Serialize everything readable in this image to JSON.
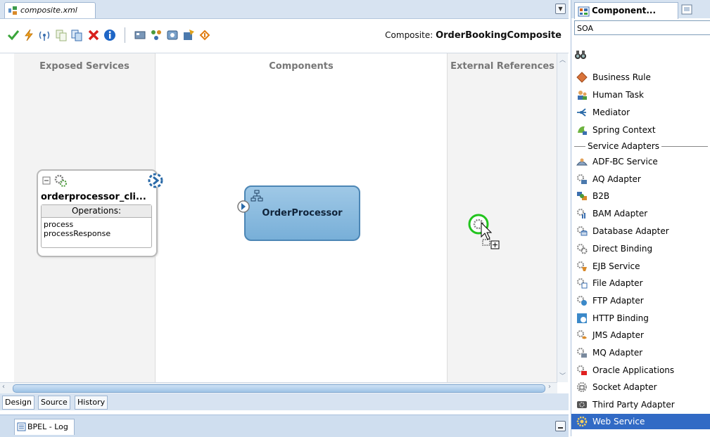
{
  "editor_tab": {
    "label": "composite.xml",
    "icon": "composite-file-icon"
  },
  "toolbar": {
    "buttons": [
      "validate-check-icon",
      "lightning-icon",
      "wireless-icon",
      "copy-doc-icon",
      "paste-doc-icon",
      "delete-x-icon",
      "info-icon",
      "tool-1-icon",
      "tool-2-icon",
      "tool-3-icon",
      "tool-4-icon",
      "tool-5-icon"
    ],
    "composite_prefix": "Composite:",
    "composite_name": "OrderBookingComposite"
  },
  "canvas": {
    "lanes": {
      "services": "Exposed Services",
      "components": "Components",
      "references": "External References"
    },
    "service": {
      "name": "orderprocessor_cli...",
      "ops_header": "Operations:",
      "ops": [
        "process",
        "processResponse"
      ]
    },
    "component": {
      "name": "OrderProcessor"
    }
  },
  "design_tabs": [
    "Design",
    "Source",
    "History"
  ],
  "log_tab": {
    "label": "BPEL - Log"
  },
  "palette": {
    "tab_label": "Component...",
    "category": "SOA",
    "section": "Service Adapters",
    "items": [
      {
        "label": "Business Rule",
        "icon": "business-rule-icon"
      },
      {
        "label": "Human Task",
        "icon": "human-task-icon"
      },
      {
        "label": "Mediator",
        "icon": "mediator-icon"
      },
      {
        "label": "Spring Context",
        "icon": "spring-context-icon"
      }
    ],
    "adapters": [
      {
        "label": "ADF-BC Service",
        "icon": "adf-bc-icon"
      },
      {
        "label": "AQ Adapter",
        "icon": "aq-adapter-icon"
      },
      {
        "label": "B2B",
        "icon": "b2b-icon"
      },
      {
        "label": "BAM Adapter",
        "icon": "bam-adapter-icon"
      },
      {
        "label": "Database Adapter",
        "icon": "database-adapter-icon"
      },
      {
        "label": "Direct Binding",
        "icon": "direct-binding-icon"
      },
      {
        "label": "EJB Service",
        "icon": "ejb-service-icon"
      },
      {
        "label": "File Adapter",
        "icon": "file-adapter-icon"
      },
      {
        "label": "FTP Adapter",
        "icon": "ftp-adapter-icon"
      },
      {
        "label": "HTTP Binding",
        "icon": "http-binding-icon"
      },
      {
        "label": "JMS Adapter",
        "icon": "jms-adapter-icon"
      },
      {
        "label": "MQ Adapter",
        "icon": "mq-adapter-icon"
      },
      {
        "label": "Oracle Applications",
        "icon": "oracle-apps-icon"
      },
      {
        "label": "Socket Adapter",
        "icon": "socket-adapter-icon"
      },
      {
        "label": "Third Party Adapter",
        "icon": "third-party-adapter-icon"
      },
      {
        "label": "Web Service",
        "icon": "web-service-icon",
        "selected": true
      }
    ]
  },
  "colors": {
    "selection": "#316ac5",
    "component_fill": "#8fbde0",
    "lane_fill": "#f3f3f3"
  }
}
